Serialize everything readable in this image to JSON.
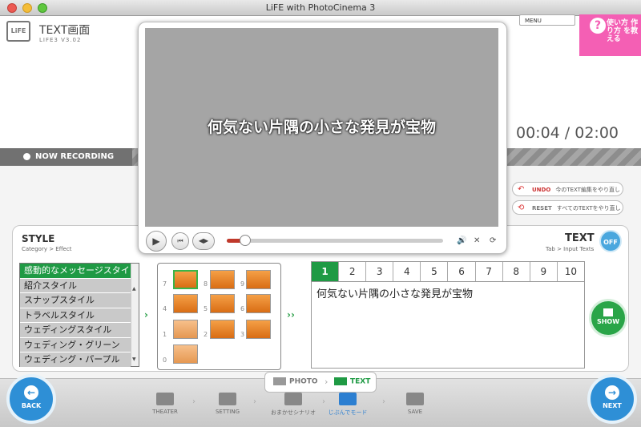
{
  "window": {
    "title": "LiFE with PhotoCinema 3"
  },
  "header": {
    "screen_title": "TEXT画面",
    "screen_subtitle": "LIFE3 V3.02",
    "logo": "LiFE",
    "menu_label": "MENU",
    "help_text": "使い方 作り方 を教える"
  },
  "timer": {
    "text": "00:04 / 02:00",
    "current": "00:04",
    "total": "02:00"
  },
  "recording": {
    "label": "NOW RECORDING"
  },
  "actions": {
    "undo_label": "UNDO",
    "undo_desc": "今のTEXT編集をやり直し",
    "reset_label": "RESET",
    "reset_desc": "すべてのTEXTをやり直し"
  },
  "player": {
    "caption": "何気ない片隅の小さな発見が宝物",
    "progress": 0.06,
    "play_icon": "play-icon",
    "prev_icon": "skip-back-icon",
    "step_icon": "frame-step-icon",
    "volume_icon": "speaker-icon",
    "mute_icon": "mute-icon",
    "loop_icon": "loop-icon"
  },
  "style_panel": {
    "title": "STYLE",
    "subtitle": "Category > Effect",
    "items": [
      "感動的なメッセージスタイ",
      "紹介スタイル",
      "スナップスタイル",
      "トラベルスタイル",
      "ウェディングスタイル",
      "ウェディング・グリーン",
      "ウェディング・パープル"
    ],
    "selected_index": 0
  },
  "effects": {
    "numbers": [
      "7",
      "8",
      "9",
      "4",
      "5",
      "6",
      "1",
      "2",
      "3",
      "0"
    ]
  },
  "text_panel": {
    "title": "TEXT",
    "subtitle": "Tab > Input Texts",
    "off_label": "OFF",
    "tabs": [
      "1",
      "2",
      "3",
      "4",
      "5",
      "6",
      "7",
      "8",
      "9",
      "10"
    ],
    "selected_tab": 0,
    "content": "何気ない片隅の小さな発見が宝物",
    "show_label": "SHOW"
  },
  "mode_switch": {
    "photo": "PHOTO",
    "text": "TEXT"
  },
  "nav": {
    "back": "BACK",
    "next": "NEXT",
    "steps": [
      "THEATER",
      "SETTING",
      "おまかせシナリオ",
      "じぶんでモード",
      "SAVE"
    ],
    "active_step": 3
  },
  "colors": {
    "accent_green": "#1f9a44",
    "accent_blue": "#2e8fd6",
    "pink": "#f45fb4",
    "seek_red": "#c0392b"
  }
}
